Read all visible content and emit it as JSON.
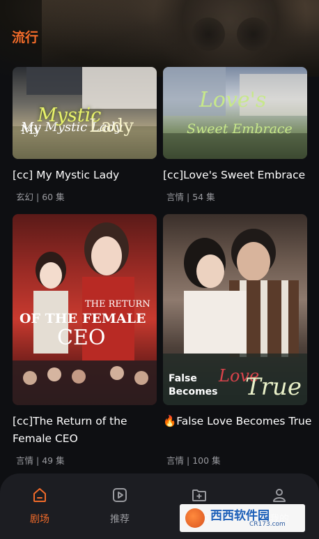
{
  "header": {
    "title": "流行"
  },
  "dramas": [
    {
      "title": "[cc] My Mystic Lady",
      "genre": "玄幻",
      "episodes": "60 集",
      "poster_text": [
        "My Mystic Lady"
      ]
    },
    {
      "title": "[cc]Love's Sweet  Embrace",
      "genre": "言情",
      "episodes": "54 集",
      "poster_text": [
        "Love's",
        "Sweet Embrace"
      ]
    },
    {
      "title": "[cc]The Return of the Female CEO",
      "genre": "言情",
      "episodes": "49 集",
      "poster_text": [
        "THE RETURN",
        "OF THE FEMALE",
        "CEO"
      ]
    },
    {
      "title": "🔥False Love Becomes True",
      "genre": "言情",
      "episodes": "100 集",
      "poster_text": [
        "False",
        "Love",
        "Becomes",
        "True"
      ]
    }
  ],
  "meta_separator": "|",
  "bottom_nav": [
    {
      "label": "剧场",
      "icon": "home-icon",
      "active": true
    },
    {
      "label": "推荐",
      "icon": "play-icon",
      "active": false
    },
    {
      "label": "我的",
      "icon": "folder-plus-icon",
      "active": false
    },
    {
      "label": "我的",
      "icon": "user-icon",
      "active": false
    }
  ],
  "watermark": {
    "text": "西西软件园",
    "sub": "CR173.com"
  },
  "colors": {
    "accent": "#f26b2a",
    "background": "#0e0f12",
    "nav_bg": "#1c1d22",
    "meta_text": "#9a9ba0"
  }
}
